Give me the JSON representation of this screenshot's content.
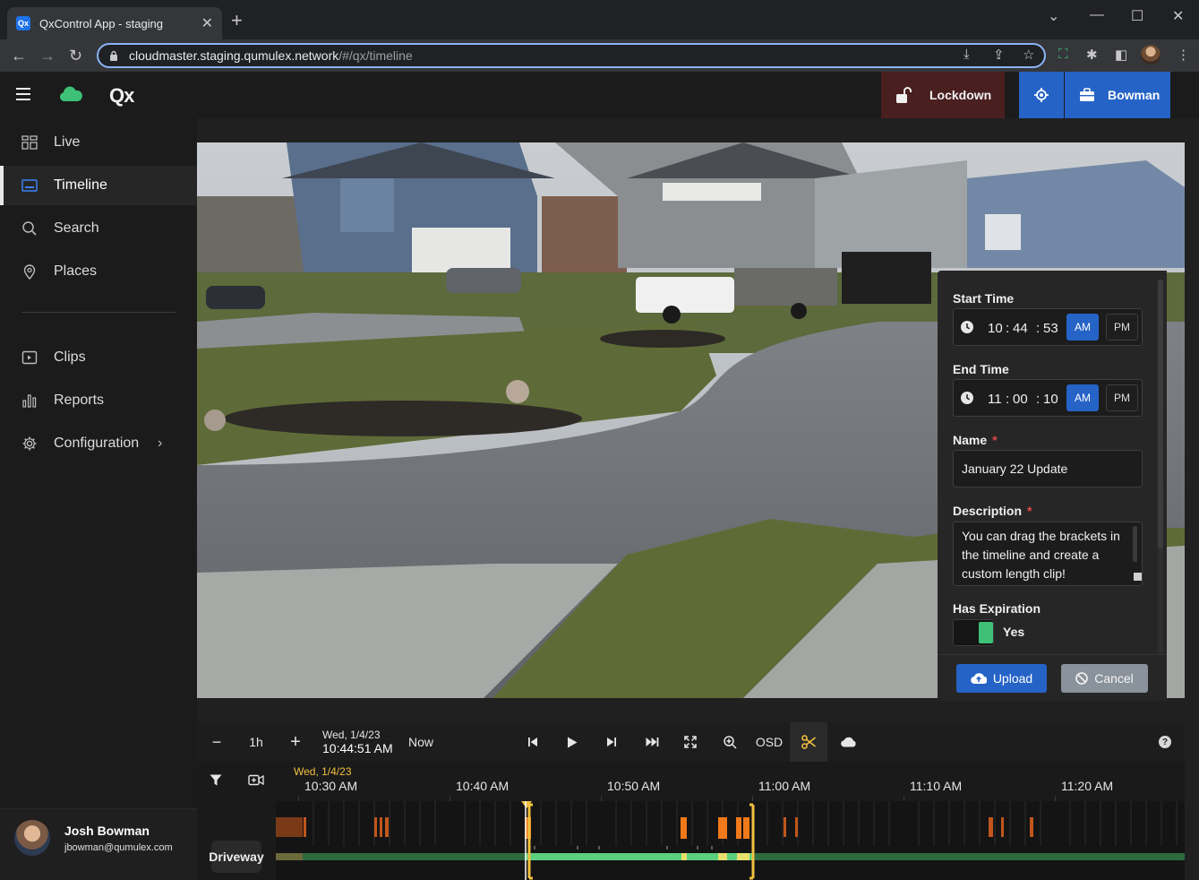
{
  "browser": {
    "tab_title": "QxControl App - staging",
    "favicon": "Qx",
    "url_host": "cloudmaster.staging.qumulex.network",
    "url_path": "/#/qx/timeline"
  },
  "header": {
    "logo_text": "Qx",
    "lockdown_label": "Lockdown",
    "account_label": "Bowman",
    "colors": {
      "lockdown_bg": "#4a1f1f",
      "accent": "#2563c7",
      "cloud": "#3ec176"
    }
  },
  "sidebar": {
    "items": [
      {
        "label": "Live",
        "icon": "grid-icon"
      },
      {
        "label": "Timeline",
        "icon": "timeline-icon",
        "active": true
      },
      {
        "label": "Search",
        "icon": "search-icon"
      },
      {
        "label": "Places",
        "icon": "map-pin-icon"
      },
      {
        "label": "Clips",
        "icon": "clips-icon"
      },
      {
        "label": "Reports",
        "icon": "bar-chart-icon"
      },
      {
        "label": "Configuration",
        "icon": "gear-icon"
      }
    ],
    "user": {
      "name": "Josh Bowman",
      "email": "jbowman@qumulex.com"
    }
  },
  "clip_panel": {
    "start_label": "Start Time",
    "start": {
      "h": "10",
      "m": "44",
      "s": "53",
      "am": "AM",
      "pm": "PM",
      "selected": "AM"
    },
    "end_label": "End Time",
    "end": {
      "h": "11",
      "m": "00",
      "s": "10",
      "am": "AM",
      "pm": "PM",
      "selected": "AM"
    },
    "name_label": "Name",
    "name_value": "January 22 Update",
    "required_mark": "*",
    "description_label": "Description",
    "description_value": "You can drag the brackets in the timeline and create a custom length clip!",
    "expiration_label": "Has Expiration",
    "expiration_value": "Yes",
    "upload_label": "Upload",
    "cancel_label": "Cancel"
  },
  "controls": {
    "zoom_out": "−",
    "range": "1h",
    "zoom_in": "+",
    "date": "Wed, 1/4/23",
    "time": "10:44:51 AM",
    "now_label": "Now",
    "osd_label": "OSD",
    "help": "?"
  },
  "timeline": {
    "date": "Wed, 1/4/23",
    "ticks": [
      "10:30 AM",
      "10:40 AM",
      "10:50 AM",
      "11:00 AM",
      "11:10 AM",
      "11:20 AM"
    ],
    "camera": "Driveway"
  }
}
